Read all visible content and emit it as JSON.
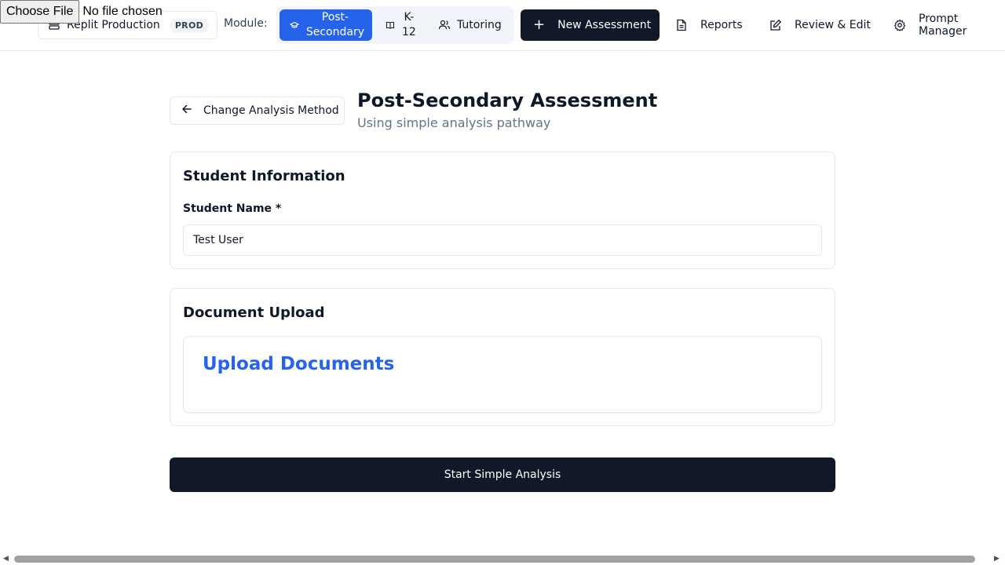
{
  "file_input": {
    "button": "Choose File",
    "status": "No file chosen"
  },
  "header": {
    "environment": {
      "label": "Replit Production",
      "badge": "PROD",
      "icon": "server-icon"
    },
    "module_label": "Module:",
    "modules": [
      {
        "label": "Post-Secondary",
        "line1": "Post-",
        "line2": "Secondary",
        "icon": "graduation-cap-icon",
        "active": true
      },
      {
        "label": "K-12",
        "line1": "K-",
        "line2": "12",
        "icon": "book-icon",
        "active": false
      },
      {
        "label": "Tutoring",
        "icon": "users-icon",
        "active": false
      }
    ],
    "new_assessment": {
      "label": "New Assessment",
      "icon": "plus-icon"
    },
    "nav": [
      {
        "label": "Reports",
        "icon": "file-text-icon"
      },
      {
        "label": "Review & Edit",
        "icon": "edit-icon"
      },
      {
        "label": "Prompt Manager",
        "icon": "gear-icon"
      }
    ]
  },
  "main": {
    "back_button": {
      "label": "Change Analysis Method",
      "icon": "arrow-left-icon"
    },
    "title": "Post-Secondary Assessment",
    "subtitle": "Using simple analysis pathway",
    "student_card": {
      "title": "Student Information",
      "field_label": "Student Name *",
      "field_value": "Test User"
    },
    "document_card": {
      "title": "Document Upload",
      "upload_heading": "Upload Documents"
    },
    "start_button": "Start Simple Analysis"
  },
  "colors": {
    "primary": "#2563eb",
    "dark": "#111827",
    "border": "#e5e7eb",
    "muted": "#64748b"
  }
}
